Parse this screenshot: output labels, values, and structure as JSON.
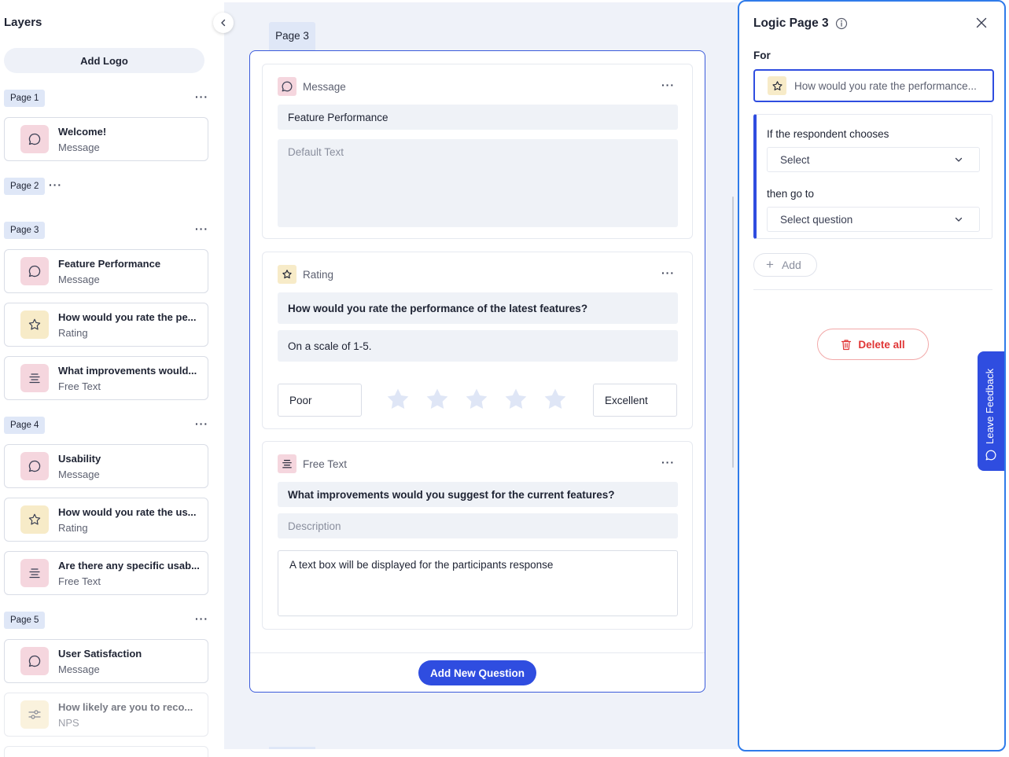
{
  "layers": {
    "title": "Layers",
    "add_logo": "Add Logo",
    "pages": [
      {
        "chip": "Page 1",
        "dots": "···",
        "items": [
          {
            "title": "Welcome!",
            "type": "Message",
            "icon": "message-icon"
          }
        ]
      },
      {
        "chip": "Page 2",
        "dots": "···",
        "items": []
      },
      {
        "chip": "Page 3",
        "dots": "···",
        "items": [
          {
            "title": "Feature Performance",
            "type": "Message",
            "icon": "message-icon"
          },
          {
            "title": "How would you rate the pe...",
            "type": "Rating",
            "icon": "star-icon"
          },
          {
            "title": "What improvements would...",
            "type": "Free Text",
            "icon": "text-lines-icon"
          }
        ]
      },
      {
        "chip": "Page 4",
        "dots": "···",
        "items": [
          {
            "title": "Usability",
            "type": "Message",
            "icon": "message-icon"
          },
          {
            "title": "How would you rate the us...",
            "type": "Rating",
            "icon": "star-icon"
          },
          {
            "title": "Are there any specific usab...",
            "type": "Free Text",
            "icon": "text-lines-icon"
          }
        ]
      },
      {
        "chip": "Page 5",
        "dots": "···",
        "items": [
          {
            "title": "User Satisfaction",
            "type": "Message",
            "icon": "message-icon"
          },
          {
            "title": "How likely are you to reco...",
            "type": "NPS",
            "icon": "sliders-icon"
          }
        ]
      }
    ]
  },
  "canvas": {
    "page_tab": "Page 3",
    "questions": [
      {
        "type_label": "Message",
        "dots": "···",
        "title": "Feature Performance",
        "text_placeholder": "Default Text"
      },
      {
        "type_label": "Rating",
        "dots": "···",
        "title": "How would you rate the performance of the latest features?",
        "subtitle": "On a scale of 1-5.",
        "low_label": "Poor",
        "high_label": "Excellent",
        "star_count": 5
      },
      {
        "type_label": "Free Text",
        "dots": "···",
        "title": "What improvements would you suggest for the current features?",
        "description_placeholder": "Description",
        "textbox_hint": "A text box will be displayed for the participants response"
      }
    ],
    "add_question": "Add New Question"
  },
  "logic": {
    "title": "Logic Page 3",
    "for_label": "For",
    "for_value": "How would you rate the performance...",
    "if_label": "If the respondent chooses",
    "select_value": "Select",
    "then_label": "then go to",
    "question_value": "Select question",
    "add_label": "Add",
    "delete_all": "Delete all"
  },
  "feedback_tab": "Leave Feedback",
  "colors": {
    "accent": "#2f4de0",
    "panel_border": "#2f7bea",
    "danger": "#e03535",
    "message_tint": "#f5d6de",
    "rating_tint": "#f7ebc8",
    "canvas_bg": "#eff2f9"
  }
}
